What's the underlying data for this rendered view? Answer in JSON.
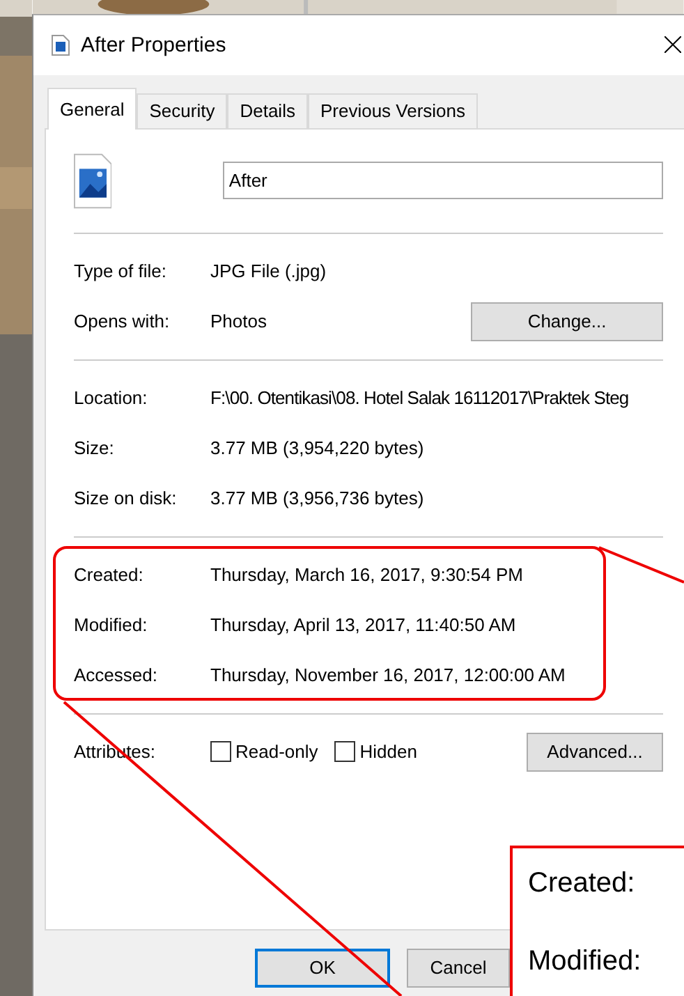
{
  "window": {
    "title": "After Properties"
  },
  "tabs": [
    {
      "label": "General",
      "selected": true
    },
    {
      "label": "Security",
      "selected": false
    },
    {
      "label": "Details",
      "selected": false
    },
    {
      "label": "Previous Versions",
      "selected": false
    }
  ],
  "file": {
    "name": "After"
  },
  "sections": [
    {
      "highlighted": false,
      "rows": [
        {
          "kind": "text",
          "label": "Type of file:",
          "value": "JPG File (.jpg)"
        },
        {
          "kind": "text",
          "label": "Opens with:",
          "value": "Photos",
          "button": "Change..."
        }
      ]
    },
    {
      "highlighted": false,
      "rows": [
        {
          "kind": "text",
          "label": "Location:",
          "value": "F:\\00. Otentikasi\\08. Hotel Salak 16112017\\Praktek Steg"
        },
        {
          "kind": "text",
          "label": "Size:",
          "value": "3.77 MB (3,954,220 bytes)"
        },
        {
          "kind": "text",
          "label": "Size on disk:",
          "value": "3.77 MB (3,956,736 bytes)"
        }
      ]
    },
    {
      "highlighted": true,
      "rows": [
        {
          "kind": "text",
          "label": "Created:",
          "value": "Thursday, March 16, 2017, 9:30:54 PM"
        },
        {
          "kind": "text",
          "label": "Modified:",
          "value": "Thursday, April 13, 2017, 11:40:50 AM"
        },
        {
          "kind": "text",
          "label": "Accessed:",
          "value": "Thursday, November 16, 2017, 12:00:00 AM"
        }
      ]
    },
    {
      "highlighted": false,
      "rows": [
        {
          "kind": "attributes",
          "label": "Attributes:",
          "checkboxes": [
            {
              "label": "Read-only",
              "checked": false
            },
            {
              "label": "Hidden",
              "checked": false
            }
          ],
          "button": "Advanced..."
        }
      ]
    }
  ],
  "buttons": [
    {
      "label": "OK",
      "default": true
    },
    {
      "label": "Cancel",
      "default": false
    }
  ],
  "callout": {
    "labels": [
      "Created:",
      "Modified:"
    ]
  }
}
